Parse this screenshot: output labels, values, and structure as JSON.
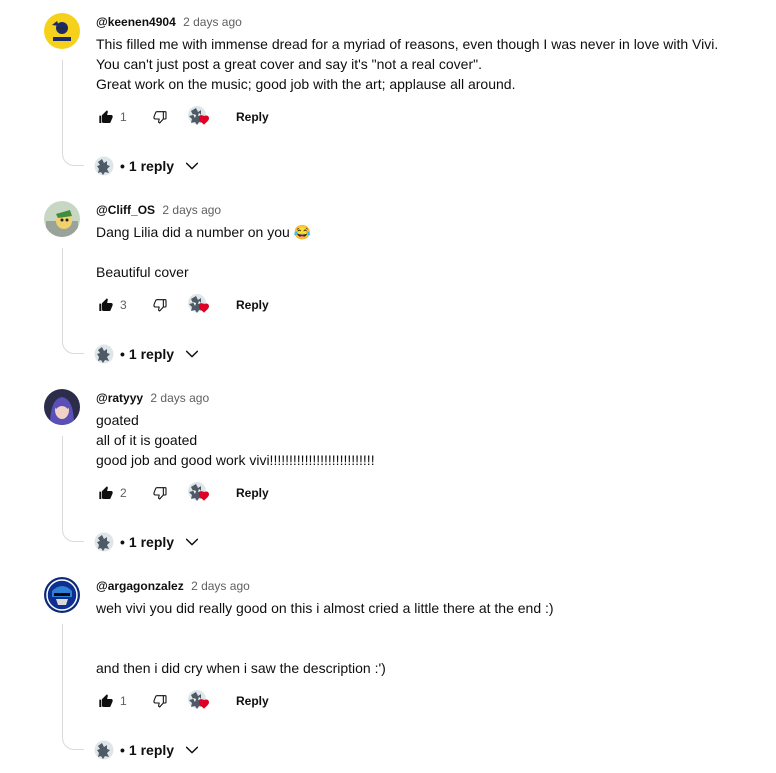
{
  "comments": [
    {
      "author": "@keenen4904",
      "time": "2 days ago",
      "lines": [
        "This filled me with immense dread for a myriad of reasons, even though I was never in love with Vivi.",
        "You can't just post a great cover and say it's \"not a real cover\".",
        "Great work on the music; good job with the art; applause all around."
      ],
      "likes": "1",
      "reply_label": "Reply",
      "replies_label": "1 reply",
      "avatar_icon": "yellow-avatar"
    },
    {
      "author": "@Cliff_OS",
      "time": "2 days ago",
      "lines": [
        "Dang Lilia did a number on you 😂",
        "",
        "Beautiful cover"
      ],
      "likes": "3",
      "reply_label": "Reply",
      "replies_label": "1 reply",
      "avatar_icon": "cartoon-avatar"
    },
    {
      "author": "@ratyyy",
      "time": "2 days ago",
      "lines": [
        "goated",
        "all of it is goated",
        "good job and good work vivi!!!!!!!!!!!!!!!!!!!!!!!!!!!"
      ],
      "likes": "2",
      "reply_label": "Reply",
      "replies_label": "1 reply",
      "avatar_icon": "anime-avatar"
    },
    {
      "author": "@argagonzalez",
      "time": "2 days ago",
      "lines": [
        "weh vivi you did really good on this i almost cried a little there at the end :)",
        "",
        "",
        "and then i did cry when i saw the description :')"
      ],
      "likes": "1",
      "reply_label": "Reply",
      "replies_label": "1 reply",
      "avatar_icon": "helmet-avatar"
    }
  ],
  "colors": {
    "text": "#0f0f0f",
    "secondary": "#606060",
    "heart": "#e00025",
    "thread_line": "#d9d9d9"
  }
}
